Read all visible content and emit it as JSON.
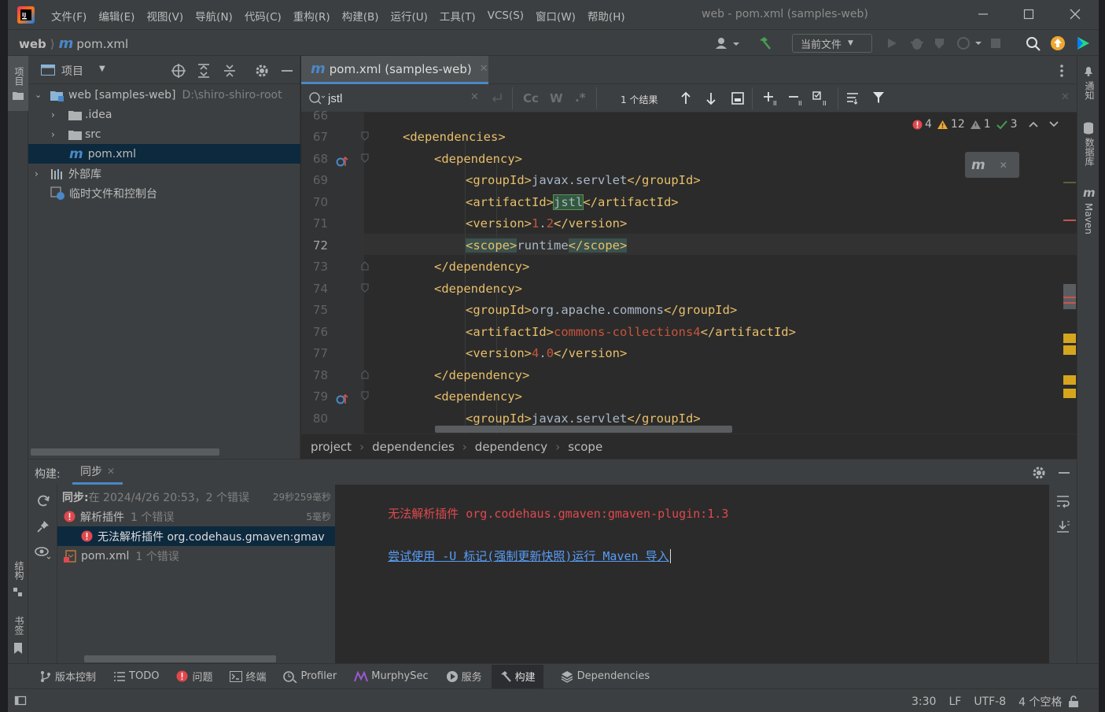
{
  "window": {
    "title": "web - pom.xml (samples-web)",
    "menu": [
      "文件(F)",
      "编辑(E)",
      "视图(V)",
      "导航(N)",
      "代码(C)",
      "重构(R)",
      "构建(B)",
      "运行(U)",
      "工具(T)",
      "VCS(S)",
      "窗口(W)",
      "帮助(H)"
    ]
  },
  "navbar": {
    "project": "web",
    "file": "pom.xml",
    "run_config": "当前文件"
  },
  "left_strip": {
    "project_label": "项目",
    "structure_label": "结构",
    "bookmarks_label": "书签"
  },
  "right_strip": {
    "notifications_label": "通知",
    "database_label": "数据库",
    "maven_label": "Maven"
  },
  "project_panel": {
    "title": "项目",
    "tree": [
      {
        "label": "web [samples-web]",
        "path": "D:\\shiro-shiro-root"
      },
      {
        "label": ".idea"
      },
      {
        "label": "src"
      },
      {
        "label": "pom.xml"
      },
      {
        "label": "外部库"
      },
      {
        "label": "临时文件和控制台"
      }
    ]
  },
  "editor": {
    "tab_label": "pom.xml (samples-web)",
    "search_value": "jstl",
    "search_opt_case": "Cc",
    "search_opt_word": "W",
    "search_opt_regex": ".*",
    "result_count": "1 个结果",
    "inspections": {
      "errors": "4",
      "warnings": "12",
      "weak_warnings": "1",
      "ok": "3"
    },
    "line_numbers": [
      "66",
      "67",
      "68",
      "69",
      "70",
      "71",
      "72",
      "73",
      "74",
      "75",
      "76",
      "77",
      "78",
      "79",
      "80"
    ],
    "lines": {
      "l67_tag": "<dependencies>",
      "l68_tag": "<dependency>",
      "l69_open": "<groupId>",
      "l69_text": "javax.servlet",
      "l69_close": "</groupId>",
      "l70_open": "<artifactId>",
      "l70_text": "jstl",
      "l70_close": "</artifactId>",
      "l71_open": "<version>",
      "l71_num1": "1",
      "l71_dot": ".",
      "l71_num2": "2",
      "l71_close": "</version>",
      "l72_open": "<scope>",
      "l72_text": "runtime",
      "l72_close": "</scope>",
      "l73_tag": "</dependency>",
      "l74_tag": "<dependency>",
      "l75_open": "<groupId>",
      "l75_text": "org.apache.commons",
      "l75_close": "</groupId>",
      "l76_open": "<artifactId>",
      "l76_text": "commons-collections4",
      "l76_close": "</artifactId>",
      "l77_open": "<version>",
      "l77_num1": "4",
      "l77_dot": ".",
      "l77_num2": "0",
      "l77_close": "</version>",
      "l78_tag": "</dependency>",
      "l79_tag": "<dependency>",
      "l80_open": "<groupId>",
      "l80_text": "javax.servlet",
      "l80_close": "</groupId>"
    },
    "breadcrumbs": [
      "project",
      "dependencies",
      "dependency",
      "scope"
    ]
  },
  "build_panel": {
    "title": "构建:",
    "tab": "同步",
    "tree": {
      "sync_label": "同步:",
      "sync_text": "在 2024/4/26 20:53，2 个错误",
      "sync_time": "29秒259毫秒",
      "parse_label": "解析插件",
      "parse_count": "1 个错误",
      "parse_time": "5毫秒",
      "error_label": "无法解析插件 org.codehaus.gmaven:gmav",
      "pom_label": "pom.xml",
      "pom_count": "1 个错误"
    },
    "console": {
      "line1_prefix": "无法解析插件 ",
      "line1_artifact": "org.codehaus.gmaven:gmaven-plugin:1.3",
      "line2_link": "尝试使用 -U 标记(强制更新快照)运行 Maven 导入"
    }
  },
  "bottom_tools": [
    "版本控制",
    "TODO",
    "问题",
    "终端",
    "Profiler",
    "MurphySec",
    "服务",
    "构建",
    "Dependencies"
  ],
  "status": {
    "position": "3:30",
    "line_sep": "LF",
    "encoding": "UTF-8",
    "indent": "4 个空格"
  },
  "colors": {
    "accent": "#4a88c7",
    "error": "#e0484e",
    "warning": "#f0a732",
    "link": "#589df6",
    "tag": "#e8bf6a",
    "number": "#c6543c"
  }
}
